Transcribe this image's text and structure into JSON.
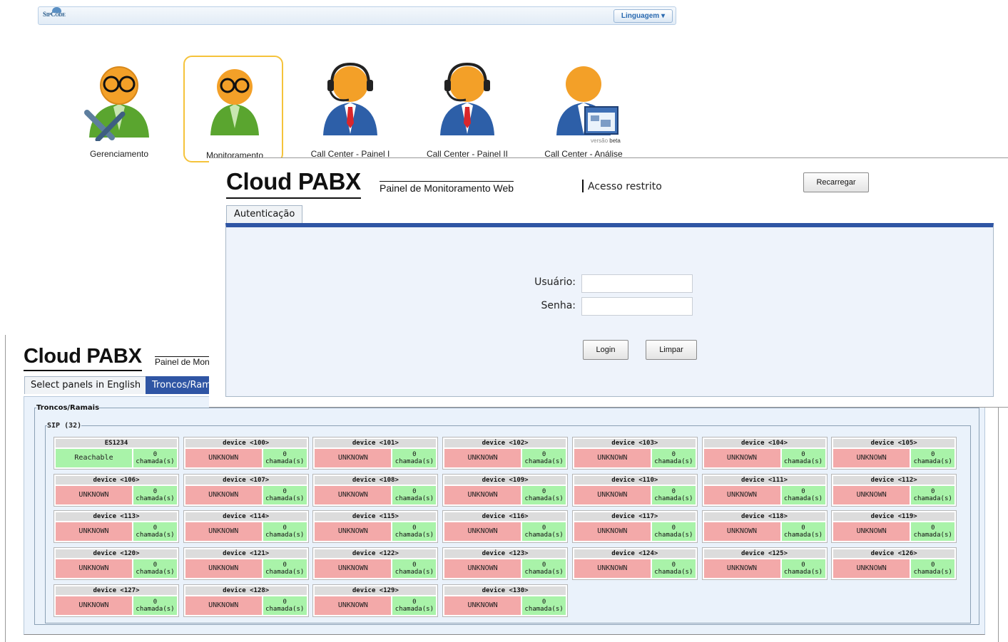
{
  "topbar": {
    "logo": "SIPCODE",
    "language_button": "Linguagem ▾"
  },
  "launcher": [
    {
      "label": "Gerenciamento"
    },
    {
      "label": "Monitoramento"
    },
    {
      "label": "Call Center - Painel I"
    },
    {
      "label": "Call Center - Painel II"
    },
    {
      "label": "Call Center - Análise"
    }
  ],
  "beta_badge": {
    "prefix": "versão",
    "word": "beta"
  },
  "login_panel": {
    "title": "Cloud PABX",
    "subtitle": "Painel de Monitoramento Web",
    "restricted": "Acesso restrito",
    "reload_button": "Recarregar",
    "tab": "Autenticação",
    "user_label": "Usuário:",
    "password_label": "Senha:",
    "user_value": "",
    "password_value": "",
    "login_button": "Login",
    "clear_button": "Limpar"
  },
  "monitor_panel": {
    "title": "Cloud PABX",
    "subtitle": "Painel de Monito",
    "tabs": [
      "Select panels in English",
      "Troncos/Ramais"
    ],
    "group_legend": "Troncos/Ramais",
    "sip_legend": "SIP (32)",
    "calls_unit": "chamada(s)",
    "devices": [
      {
        "name": "ES1234",
        "status": "Reachable",
        "calls": "0"
      },
      {
        "name": "device <100>",
        "status": "UNKNOWN",
        "calls": "0"
      },
      {
        "name": "device <101>",
        "status": "UNKNOWN",
        "calls": "0"
      },
      {
        "name": "device <102>",
        "status": "UNKNOWN",
        "calls": "0"
      },
      {
        "name": "device <103>",
        "status": "UNKNOWN",
        "calls": "0"
      },
      {
        "name": "device <104>",
        "status": "UNKNOWN",
        "calls": "0"
      },
      {
        "name": "device <105>",
        "status": "UNKNOWN",
        "calls": "0"
      },
      {
        "name": "device <106>",
        "status": "UNKNOWN",
        "calls": "0"
      },
      {
        "name": "device <107>",
        "status": "UNKNOWN",
        "calls": "0"
      },
      {
        "name": "device <108>",
        "status": "UNKNOWN",
        "calls": "0"
      },
      {
        "name": "device <109>",
        "status": "UNKNOWN",
        "calls": "0"
      },
      {
        "name": "device <110>",
        "status": "UNKNOWN",
        "calls": "0"
      },
      {
        "name": "device <111>",
        "status": "UNKNOWN",
        "calls": "0"
      },
      {
        "name": "device <112>",
        "status": "UNKNOWN",
        "calls": "0"
      },
      {
        "name": "device <113>",
        "status": "UNKNOWN",
        "calls": "0"
      },
      {
        "name": "device <114>",
        "status": "UNKNOWN",
        "calls": "0"
      },
      {
        "name": "device <115>",
        "status": "UNKNOWN",
        "calls": "0"
      },
      {
        "name": "device <116>",
        "status": "UNKNOWN",
        "calls": "0"
      },
      {
        "name": "device <117>",
        "status": "UNKNOWN",
        "calls": "0"
      },
      {
        "name": "device <118>",
        "status": "UNKNOWN",
        "calls": "0"
      },
      {
        "name": "device <119>",
        "status": "UNKNOWN",
        "calls": "0"
      },
      {
        "name": "device <120>",
        "status": "UNKNOWN",
        "calls": "0"
      },
      {
        "name": "device <121>",
        "status": "UNKNOWN",
        "calls": "0"
      },
      {
        "name": "device <122>",
        "status": "UNKNOWN",
        "calls": "0"
      },
      {
        "name": "device <123>",
        "status": "UNKNOWN",
        "calls": "0"
      },
      {
        "name": "device <124>",
        "status": "UNKNOWN",
        "calls": "0"
      },
      {
        "name": "device <125>",
        "status": "UNKNOWN",
        "calls": "0"
      },
      {
        "name": "device <126>",
        "status": "UNKNOWN",
        "calls": "0"
      },
      {
        "name": "device <127>",
        "status": "UNKNOWN",
        "calls": "0"
      },
      {
        "name": "device <128>",
        "status": "UNKNOWN",
        "calls": "0"
      },
      {
        "name": "device <129>",
        "status": "UNKNOWN",
        "calls": "0"
      },
      {
        "name": "device <130>",
        "status": "UNKNOWN",
        "calls": "0"
      }
    ]
  },
  "colors": {
    "tab_active": "#2f55a4",
    "status_ok": "#a9f3a9",
    "status_unknown": "#f3a9a9",
    "selected_border": "#f5c33b"
  }
}
